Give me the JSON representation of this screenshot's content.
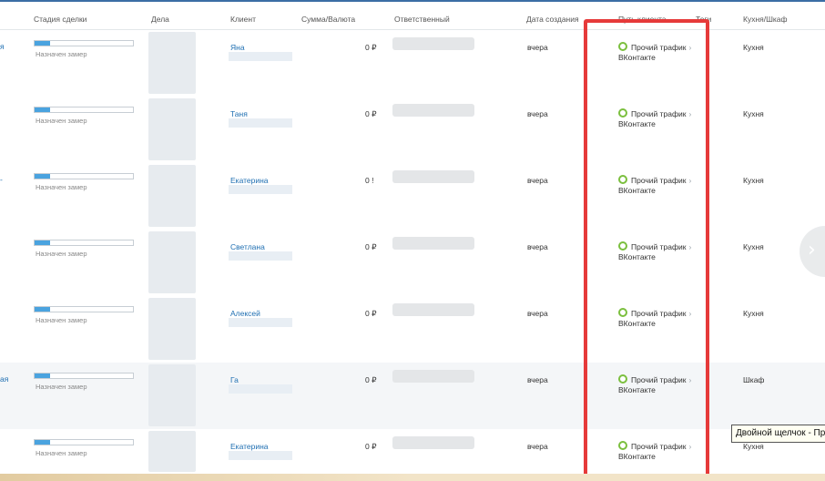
{
  "header": {
    "cols": [
      "Стадия сделки",
      "Дела",
      "Клиент",
      "Сумма/Валюта",
      "Ответственный",
      "Дата создания",
      "Путь клиента",
      "Теги",
      "Кухня/Шкаф"
    ]
  },
  "rows": [
    {
      "lead": "я",
      "stage": "Назначен замер",
      "client": "Яна",
      "sum": "0 ₽",
      "date": "вчера",
      "path_source": "Прочий трафик",
      "path_channel": "ВКонтакте",
      "kitchen": "Кухня"
    },
    {
      "lead": "",
      "stage": "Назначен замер",
      "client": "Таня",
      "sum": "0 ₽",
      "date": "вчера",
      "path_source": "Прочий трафик",
      "path_channel": "ВКонтакте",
      "kitchen": "Кухня"
    },
    {
      "lead": "-",
      "stage": "Назначен замер",
      "client": "Екатерина",
      "sum": "0 !",
      "date": "вчера",
      "path_source": "Прочий трафик",
      "path_channel": "ВКонтакте",
      "kitchen": "Кухня"
    },
    {
      "lead": "",
      "stage": "Назначен замер",
      "client": "Светлана",
      "sum": "0 ₽",
      "date": "вчера",
      "path_source": "Прочий трафик",
      "path_channel": "ВКонтакте",
      "kitchen": "Кухня"
    },
    {
      "lead": "",
      "stage": "Назначен замер",
      "client": "Алексей",
      "sum": "0 ₽",
      "date": "вчера",
      "path_source": "Прочий трафик",
      "path_channel": "ВКонтакте",
      "kitchen": "Кухня"
    },
    {
      "lead": "ая",
      "stage": "Назначен замер",
      "client": "Га",
      "sum": "0 ₽",
      "date": "вчера",
      "path_source": "Прочий трафик",
      "path_channel": "ВКонтакте",
      "kitchen": "Шкаф"
    },
    {
      "lead": "",
      "stage": "Назначен замер",
      "client": "Екатерина",
      "sum": "0 ₽",
      "date": "вчера",
      "path_source": "Прочий трафик",
      "path_channel": "ВКонтакте",
      "kitchen": "Кухня"
    }
  ],
  "tooltip": "Двойной щелчок - Пр",
  "icons": {
    "path_dot": "status-dot-icon",
    "path_arrow": "chevron-right-icon",
    "nav": "chevron-right-icon"
  },
  "colors": {
    "accent": "#1f6fb2",
    "highlight": "#e63a3a",
    "stage_fill": "#4aa3df",
    "dot": "#7bbf3e"
  }
}
